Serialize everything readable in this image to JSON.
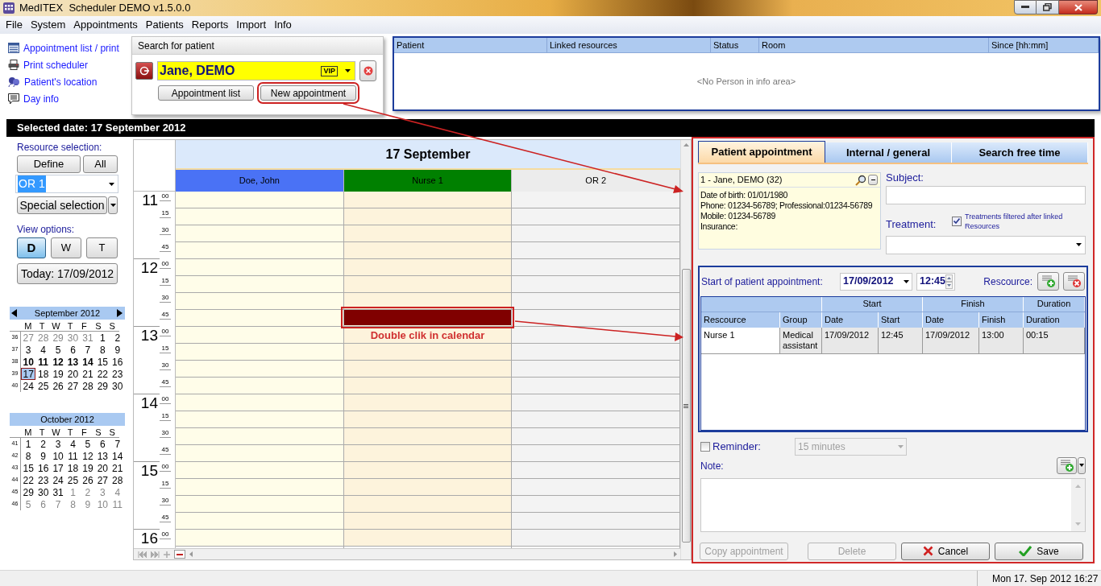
{
  "window": {
    "title": "MedITEX  Scheduler DEMO v1.5.0.0"
  },
  "menu": [
    {
      "label": "File"
    },
    {
      "label": "System"
    },
    {
      "label": "Appointments"
    },
    {
      "label": "Patients"
    },
    {
      "label": "Reports"
    },
    {
      "label": "Import"
    },
    {
      "label": "Info"
    }
  ],
  "quick_links": [
    {
      "label": "Appointment list / print",
      "kind": "list"
    },
    {
      "label": "Print scheduler",
      "kind": "printer"
    },
    {
      "label": "Patient's location",
      "kind": "people"
    },
    {
      "label": "Day info",
      "kind": "note"
    }
  ],
  "patient_search": {
    "title": "Search for patient",
    "patient": "Jane, DEMO",
    "badge": "VIP",
    "buttons": [
      {
        "label": "Appointment list",
        "highlighted": false
      },
      {
        "label": "New appointment",
        "highlighted": true
      }
    ]
  },
  "info_table": {
    "columns": [
      "Patient",
      "Linked resources",
      "Status",
      "Room",
      "Since [hh:mm]"
    ],
    "empty_text": "<No Person in info area>"
  },
  "selected_date": "Selected date: 17 September 2012",
  "sidebar": {
    "resource_label": "Resource selection:",
    "define": "Define",
    "all": "All",
    "resource": "OR 1",
    "special": "Special selection",
    "view_label": "View options:",
    "views": [
      {
        "label": "D",
        "selected": true
      },
      {
        "label": "W",
        "selected": false
      },
      {
        "label": "T",
        "selected": false
      }
    ],
    "today": "Today: 17/09/2012",
    "months": [
      {
        "title": "September 2012",
        "nav": true,
        "weekdays": [
          "M",
          "T",
          "W",
          "T",
          "F",
          "S",
          "S"
        ],
        "weeks": [
          {
            "number": "36",
            "days": [
              {
                "label": "27",
                "muted": true,
                "bold": false,
                "selected": false
              },
              {
                "label": "28",
                "muted": true,
                "bold": false,
                "selected": false
              },
              {
                "label": "29",
                "muted": true,
                "bold": false,
                "selected": false
              },
              {
                "label": "30",
                "muted": true,
                "bold": false,
                "selected": false
              },
              {
                "label": "31",
                "muted": true,
                "bold": false,
                "selected": false
              },
              {
                "label": "1",
                "muted": false,
                "bold": false,
                "selected": false
              },
              {
                "label": "2",
                "muted": false,
                "bold": false,
                "selected": false
              }
            ]
          },
          {
            "number": "37",
            "days": [
              {
                "label": "3",
                "muted": false,
                "bold": false,
                "selected": false
              },
              {
                "label": "4",
                "muted": false,
                "bold": false,
                "selected": false
              },
              {
                "label": "5",
                "muted": false,
                "bold": false,
                "selected": false
              },
              {
                "label": "6",
                "muted": false,
                "bold": false,
                "selected": false
              },
              {
                "label": "7",
                "muted": false,
                "bold": false,
                "selected": false
              },
              {
                "label": "8",
                "muted": false,
                "bold": false,
                "selected": false
              },
              {
                "label": "9",
                "muted": false,
                "bold": false,
                "selected": false
              }
            ]
          },
          {
            "number": "38",
            "days": [
              {
                "label": "10",
                "muted": false,
                "bold": true,
                "selected": false
              },
              {
                "label": "11",
                "muted": false,
                "bold": true,
                "selected": false
              },
              {
                "label": "12",
                "muted": false,
                "bold": true,
                "selected": false
              },
              {
                "label": "13",
                "muted": false,
                "bold": true,
                "selected": false
              },
              {
                "label": "14",
                "muted": false,
                "bold": true,
                "selected": false
              },
              {
                "label": "15",
                "muted": false,
                "bold": false,
                "selected": false
              },
              {
                "label": "16",
                "muted": false,
                "bold": false,
                "selected": false
              }
            ]
          },
          {
            "number": "39",
            "days": [
              {
                "label": "17",
                "muted": false,
                "bold": false,
                "selected": true
              },
              {
                "label": "18",
                "muted": false,
                "bold": false,
                "selected": false
              },
              {
                "label": "19",
                "muted": false,
                "bold": false,
                "selected": false
              },
              {
                "label": "20",
                "muted": false,
                "bold": false,
                "selected": false
              },
              {
                "label": "21",
                "muted": false,
                "bold": false,
                "selected": false
              },
              {
                "label": "22",
                "muted": false,
                "bold": false,
                "selected": false
              },
              {
                "label": "23",
                "muted": false,
                "bold": false,
                "selected": false
              }
            ]
          },
          {
            "number": "40",
            "days": [
              {
                "label": "24",
                "muted": false,
                "bold": false,
                "selected": false
              },
              {
                "label": "25",
                "muted": false,
                "bold": false,
                "selected": false
              },
              {
                "label": "26",
                "muted": false,
                "bold": false,
                "selected": false
              },
              {
                "label": "27",
                "muted": false,
                "bold": false,
                "selected": false
              },
              {
                "label": "28",
                "muted": false,
                "bold": false,
                "selected": false
              },
              {
                "label": "29",
                "muted": false,
                "bold": false,
                "selected": false
              },
              {
                "label": "30",
                "muted": false,
                "bold": false,
                "selected": false
              }
            ]
          }
        ]
      },
      {
        "title": "October 2012",
        "nav": false,
        "weekdays": [
          "M",
          "T",
          "W",
          "T",
          "F",
          "S",
          "S"
        ],
        "weeks": [
          {
            "number": "41",
            "days": [
              {
                "label": "1",
                "muted": false,
                "bold": false,
                "selected": false
              },
              {
                "label": "2",
                "muted": false,
                "bold": false,
                "selected": false
              },
              {
                "label": "3",
                "muted": false,
                "bold": false,
                "selected": false
              },
              {
                "label": "4",
                "muted": false,
                "bold": false,
                "selected": false
              },
              {
                "label": "5",
                "muted": false,
                "bold": false,
                "selected": false
              },
              {
                "label": "6",
                "muted": false,
                "bold": false,
                "selected": false
              },
              {
                "label": "7",
                "muted": false,
                "bold": false,
                "selected": false
              }
            ]
          },
          {
            "number": "42",
            "days": [
              {
                "label": "8",
                "muted": false,
                "bold": false,
                "selected": false
              },
              {
                "label": "9",
                "muted": false,
                "bold": false,
                "selected": false
              },
              {
                "label": "10",
                "muted": false,
                "bold": false,
                "selected": false
              },
              {
                "label": "11",
                "muted": false,
                "bold": false,
                "selected": false
              },
              {
                "label": "12",
                "muted": false,
                "bold": false,
                "selected": false
              },
              {
                "label": "13",
                "muted": false,
                "bold": false,
                "selected": false
              },
              {
                "label": "14",
                "muted": false,
                "bold": false,
                "selected": false
              }
            ]
          },
          {
            "number": "43",
            "days": [
              {
                "label": "15",
                "muted": false,
                "bold": false,
                "selected": false
              },
              {
                "label": "16",
                "muted": false,
                "bold": false,
                "selected": false
              },
              {
                "label": "17",
                "muted": false,
                "bold": false,
                "selected": false
              },
              {
                "label": "18",
                "muted": false,
                "bold": false,
                "selected": false
              },
              {
                "label": "19",
                "muted": false,
                "bold": false,
                "selected": false
              },
              {
                "label": "20",
                "muted": false,
                "bold": false,
                "selected": false
              },
              {
                "label": "21",
                "muted": false,
                "bold": false,
                "selected": false
              }
            ]
          },
          {
            "number": "44",
            "days": [
              {
                "label": "22",
                "muted": false,
                "bold": false,
                "selected": false
              },
              {
                "label": "23",
                "muted": false,
                "bold": false,
                "selected": false
              },
              {
                "label": "24",
                "muted": false,
                "bold": false,
                "selected": false
              },
              {
                "label": "25",
                "muted": false,
                "bold": false,
                "selected": false
              },
              {
                "label": "26",
                "muted": false,
                "bold": false,
                "selected": false
              },
              {
                "label": "27",
                "muted": false,
                "bold": false,
                "selected": false
              },
              {
                "label": "28",
                "muted": false,
                "bold": false,
                "selected": false
              }
            ]
          },
          {
            "number": "45",
            "days": [
              {
                "label": "29",
                "muted": false,
                "bold": false,
                "selected": false
              },
              {
                "label": "30",
                "muted": false,
                "bold": false,
                "selected": false
              },
              {
                "label": "31",
                "muted": false,
                "bold": false,
                "selected": false
              },
              {
                "label": "1",
                "muted": true,
                "bold": false,
                "selected": false
              },
              {
                "label": "2",
                "muted": true,
                "bold": false,
                "selected": false
              },
              {
                "label": "3",
                "muted": true,
                "bold": false,
                "selected": false
              },
              {
                "label": "4",
                "muted": true,
                "bold": false,
                "selected": false
              }
            ]
          },
          {
            "number": "46",
            "days": [
              {
                "label": "5",
                "muted": true,
                "bold": false,
                "selected": false
              },
              {
                "label": "6",
                "muted": true,
                "bold": false,
                "selected": false
              },
              {
                "label": "7",
                "muted": true,
                "bold": false,
                "selected": false
              },
              {
                "label": "8",
                "muted": true,
                "bold": false,
                "selected": false
              },
              {
                "label": "9",
                "muted": true,
                "bold": false,
                "selected": false
              },
              {
                "label": "10",
                "muted": true,
                "bold": false,
                "selected": false
              },
              {
                "label": "11",
                "muted": true,
                "bold": false,
                "selected": false
              }
            ]
          }
        ]
      }
    ]
  },
  "calendar": {
    "day_title": "17 September",
    "resources": [
      {
        "name": "Doe, John",
        "color": "#4a72f5"
      },
      {
        "name": "Nurse 1",
        "color": "#008000"
      },
      {
        "name": "OR 2",
        "color": "#ececec"
      }
    ],
    "callout": "Double clik in calendar",
    "hours": [
      {
        "hour": "11",
        "slots": [
          {
            "label": "00",
            "booked": [
              false,
              false,
              false
            ]
          },
          {
            "label": "15",
            "booked": [
              false,
              false,
              false
            ]
          },
          {
            "label": "30",
            "booked": [
              false,
              false,
              false
            ]
          },
          {
            "label": "45",
            "booked": [
              false,
              false,
              false
            ]
          }
        ]
      },
      {
        "hour": "12",
        "slots": [
          {
            "label": "00",
            "booked": [
              false,
              false,
              false
            ]
          },
          {
            "label": "15",
            "booked": [
              false,
              false,
              false
            ]
          },
          {
            "label": "30",
            "booked": [
              false,
              false,
              false
            ]
          },
          {
            "label": "45",
            "booked": [
              false,
              true,
              false
            ]
          }
        ]
      },
      {
        "hour": "13",
        "slots": [
          {
            "label": "00",
            "booked": [
              false,
              false,
              false
            ]
          },
          {
            "label": "15",
            "booked": [
              false,
              false,
              false
            ]
          },
          {
            "label": "30",
            "booked": [
              false,
              false,
              false
            ]
          },
          {
            "label": "45",
            "booked": [
              false,
              false,
              false
            ]
          }
        ]
      },
      {
        "hour": "14",
        "slots": [
          {
            "label": "00",
            "booked": [
              false,
              false,
              false
            ]
          },
          {
            "label": "15",
            "booked": [
              false,
              false,
              false
            ]
          },
          {
            "label": "30",
            "booked": [
              false,
              false,
              false
            ]
          },
          {
            "label": "45",
            "booked": [
              false,
              false,
              false
            ]
          }
        ]
      },
      {
        "hour": "15",
        "slots": [
          {
            "label": "00",
            "booked": [
              false,
              false,
              false
            ]
          },
          {
            "label": "15",
            "booked": [
              false,
              false,
              false
            ]
          },
          {
            "label": "30",
            "booked": [
              false,
              false,
              false
            ]
          },
          {
            "label": "45",
            "booked": [
              false,
              false,
              false
            ]
          }
        ]
      },
      {
        "hour": "16",
        "slots": [
          {
            "label": "00",
            "booked": [
              false,
              false,
              false
            ]
          }
        ]
      }
    ]
  },
  "appointment_panel": {
    "highlighted": true,
    "tabs": [
      {
        "label": "Patient appointment",
        "selected": true
      },
      {
        "label": "Internal / general",
        "selected": false
      },
      {
        "label": "Search free time",
        "selected": false
      }
    ],
    "patient_card": {
      "header": "1 - Jane, DEMO (32)",
      "lines": [
        "Date of birth: 01/01/1980",
        "Phone: 01234-56789; Professional:01234-56789",
        "Mobile: 01234-56789",
        "Insurance:"
      ]
    },
    "subject_label": "Subject:",
    "treatment_label": "Treatment:",
    "treatment_filter": {
      "label": "Treatments filtered after linked Resources",
      "checked": true
    },
    "start_label": "Start of patient appointment:",
    "start_date": "17/09/2012",
    "start_time": "12:45",
    "resource_label": "Rescource:",
    "grid": {
      "groups": [
        "Start",
        "Finish",
        "Duration"
      ],
      "columns": [
        "Rescource",
        "Group",
        "Date",
        "Start",
        "Date",
        "Finish",
        "Duration"
      ],
      "rows": [
        [
          "Nurse 1",
          "Medical assistant",
          "17/09/2012",
          "12:45",
          "17/09/2012",
          "13:00",
          "00:15"
        ]
      ]
    },
    "reminder": {
      "label": "Reminder:",
      "checked": false,
      "value": "15 minutes",
      "disabled": true
    },
    "note_label": "Note:",
    "buttons": [
      {
        "label": "Copy appointment",
        "kind": "plain",
        "disabled": true
      },
      {
        "label": "Delete",
        "kind": "plain",
        "disabled": true
      },
      {
        "label": "Cancel",
        "kind": "cancel",
        "disabled": false
      },
      {
        "label": "Save",
        "kind": "save",
        "disabled": false
      }
    ]
  },
  "status_bar": {
    "datetime": "Mon 17. Sep 2012 16:27"
  }
}
